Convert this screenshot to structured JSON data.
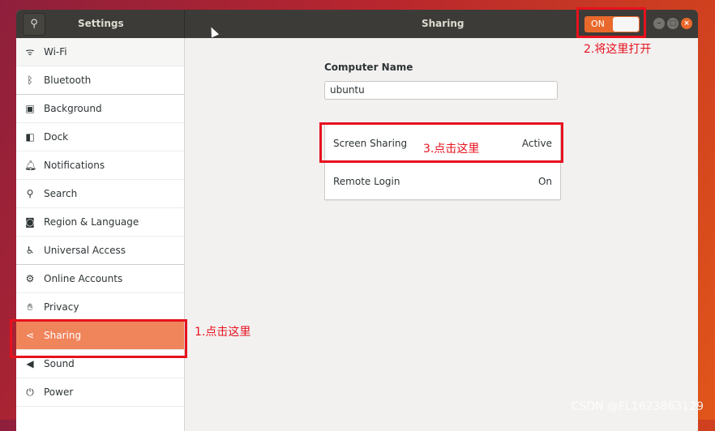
{
  "header": {
    "title": "Settings",
    "panel_title": "Sharing",
    "switch_label": "ON"
  },
  "sidebar": {
    "items": [
      {
        "label": "Wi-Fi",
        "icon": "wifi-icon",
        "glyph": "ᯤ"
      },
      {
        "label": "Bluetooth",
        "icon": "bluetooth-icon",
        "glyph": "ᛒ"
      },
      {
        "label": "Background",
        "icon": "background-icon",
        "glyph": "▣"
      },
      {
        "label": "Dock",
        "icon": "dock-icon",
        "glyph": "◧"
      },
      {
        "label": "Notifications",
        "icon": "bell-icon",
        "glyph": "🔔︎"
      },
      {
        "label": "Search",
        "icon": "search-icon",
        "glyph": "⚲"
      },
      {
        "label": "Region & Language",
        "icon": "region-icon",
        "glyph": "◙"
      },
      {
        "label": "Universal Access",
        "icon": "accessibility-icon",
        "glyph": "♿︎"
      },
      {
        "label": "Online Accounts",
        "icon": "online-accounts-icon",
        "glyph": "⚙"
      },
      {
        "label": "Privacy",
        "icon": "hand-icon",
        "glyph": "✋︎"
      },
      {
        "label": "Sharing",
        "icon": "share-icon",
        "glyph": "⋖"
      },
      {
        "label": "Sound",
        "icon": "speaker-icon",
        "glyph": "◀"
      },
      {
        "label": "Power",
        "icon": "power-icon",
        "glyph": "⏻"
      }
    ]
  },
  "main": {
    "computer_name_label": "Computer Name",
    "computer_name_value": "ubuntu",
    "services": [
      {
        "name": "Screen Sharing",
        "status": "Active"
      },
      {
        "name": "Remote Login",
        "status": "On"
      }
    ]
  },
  "annotations": {
    "a1": "1.点击这里",
    "a2": "2.将这里打开",
    "a3": "3.点击这里"
  },
  "watermark": "CSDN @FL1623863129"
}
